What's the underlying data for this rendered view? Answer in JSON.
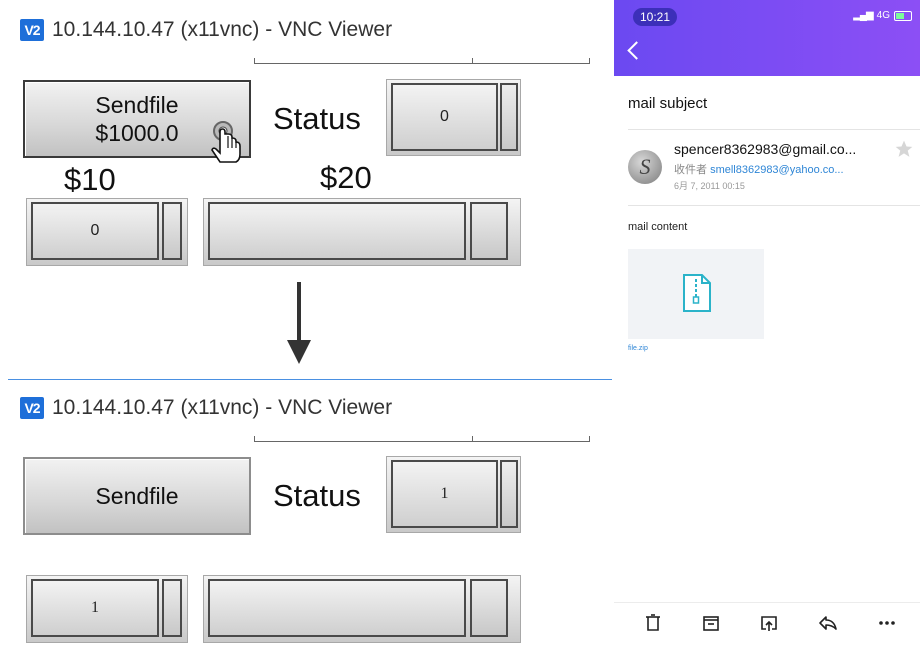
{
  "top_window": {
    "logo": "V2",
    "title": "10.144.10.47 (x11vnc) - VNC Viewer",
    "sendfile_line1": "Sendfile",
    "sendfile_line2": "$1000.0",
    "status_label": "Status",
    "status_value": "0",
    "price_10": "$10",
    "price_20": "$20",
    "field_value": "0"
  },
  "bottom_window": {
    "logo": "V2",
    "title": "10.144.10.47 (x11vnc) - VNC Viewer",
    "sendfile_label": "Sendfile",
    "status_label": "Status",
    "status_value": "1",
    "field_value": "1"
  },
  "icons": {
    "cursor": "hand-pointer-icon",
    "arrow": "arrow-down-icon",
    "back": "chevron-left-icon",
    "star": "star-icon",
    "attachment": "zip-file-icon",
    "delete": "trash-icon",
    "archive": "archive-icon",
    "move": "move-to-folder-icon",
    "reply": "reply-icon",
    "more": "more-icon"
  },
  "mail": {
    "status_time": "10:21",
    "network": "4G",
    "subject": "mail subject",
    "sender": "spencer8362983@gmail.co...",
    "to_prefix": "收件者",
    "to_address": "smell8362983@yahoo.co...",
    "date": "6月 7, 2011 00:15",
    "content": "mail content",
    "attachment_name": "file.zip"
  },
  "colors": {
    "header_start": "#6b49f1",
    "header_end": "#8c4ff5",
    "link": "#2f86d6",
    "vnc_logo": "#1e6fd9"
  }
}
